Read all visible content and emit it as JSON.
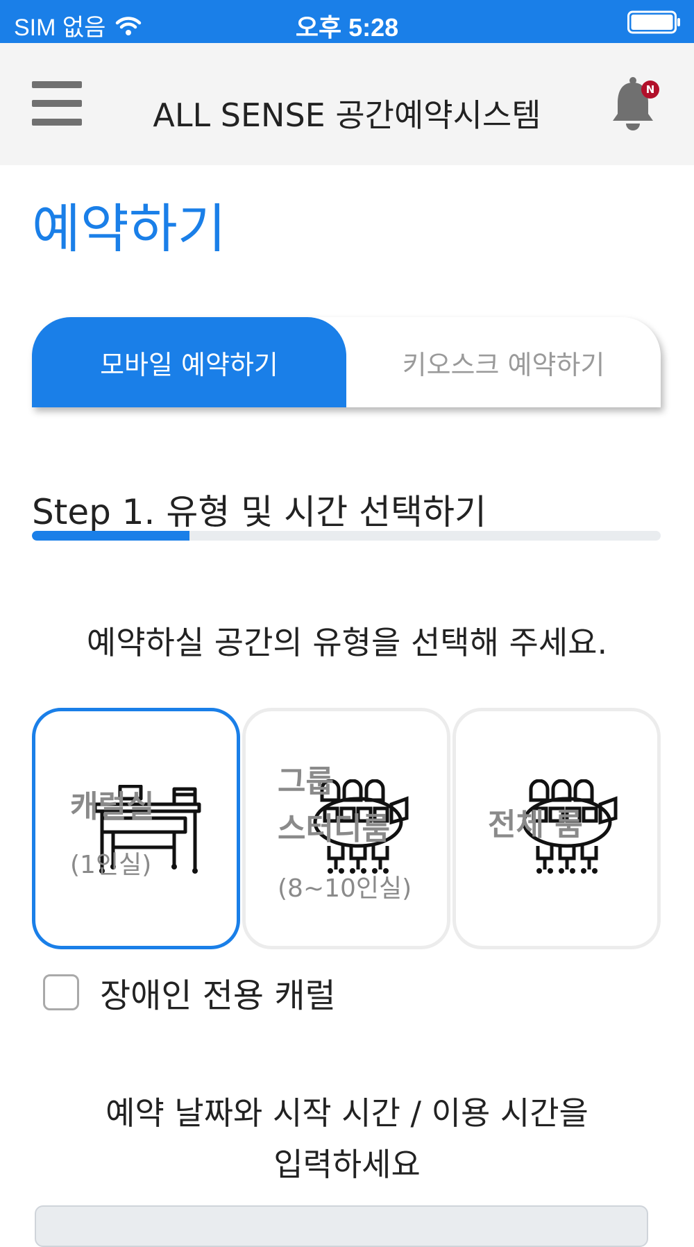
{
  "status_bar": {
    "carrier": "SIM 없음",
    "time": "오후 5:28"
  },
  "header": {
    "title": "ALL SENSE 공간예약시스템",
    "notification_badge": "N",
    "accent_color": "#1a7fe8",
    "badge_color": "#b2102a"
  },
  "page_title": "예약하기",
  "tabs": [
    {
      "label": "모바일 예약하기",
      "active": true
    },
    {
      "label": "키오스크 예약하기",
      "active": false
    }
  ],
  "step": {
    "title": "Step 1. 유형 및 시간 선택하기",
    "progress": 0.25
  },
  "type_prompt": "예약하실 공간의 유형을 선택해 주세요.",
  "space_types": [
    {
      "label": "캐럴실",
      "sub": "(1인실)",
      "icon": "desk-icon",
      "selected": true
    },
    {
      "label_line1": "그룹",
      "label_line2": "스터디룸",
      "sub": "(8~10인실)",
      "icon": "group-meeting-icon",
      "selected": false
    },
    {
      "label": "전체 룸",
      "icon": "conference-room-icon",
      "selected": false
    }
  ],
  "accessible_option": {
    "label": "장애인 전용 캐럴",
    "checked": false
  },
  "datetime_prompt_line1": "예약 날짜와 시작 시간 / 이용 시간을",
  "datetime_prompt_line2": "입력하세요"
}
